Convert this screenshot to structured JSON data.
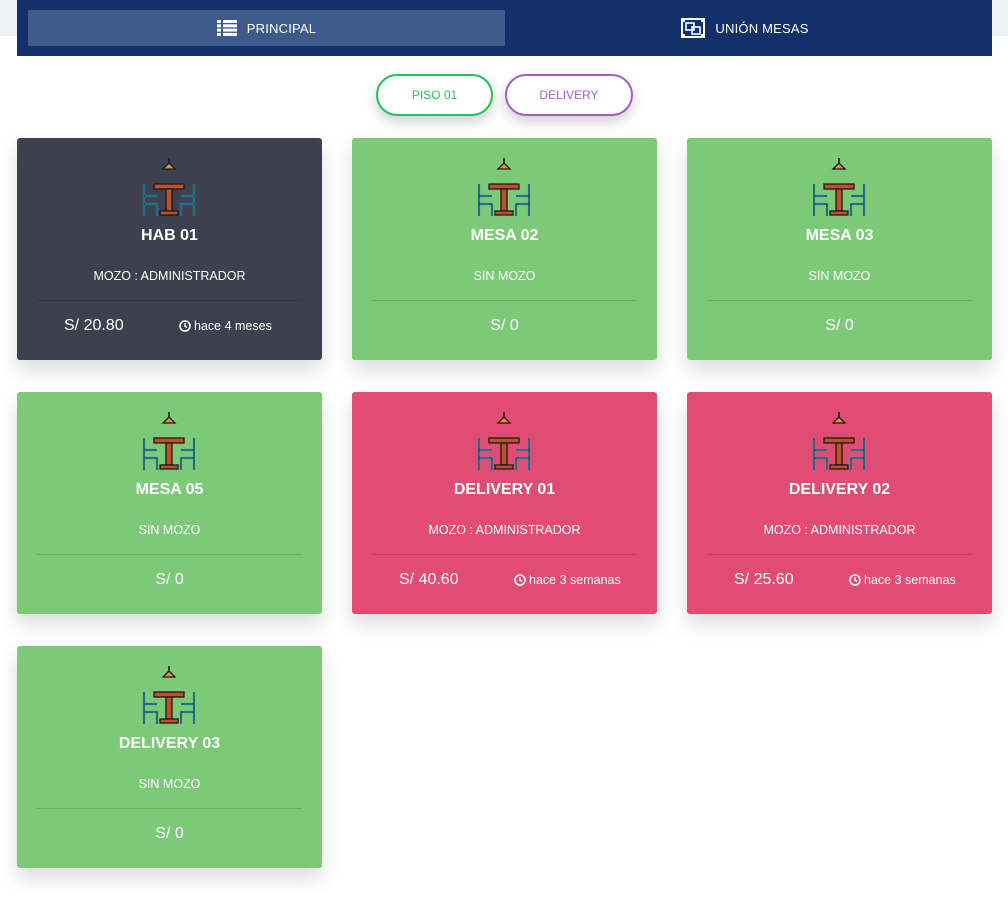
{
  "nav": {
    "tabs": [
      {
        "label": "PRINCIPAL",
        "icon": "list-icon",
        "active": true
      },
      {
        "label": "UNIÓN MESAS",
        "icon": "merge-tables-icon",
        "active": false
      }
    ]
  },
  "filters": [
    {
      "label": "PISO 01",
      "color": "#22c15a"
    },
    {
      "label": "DELIVERY",
      "color": "#a45bd0"
    }
  ],
  "colors": {
    "navbar": "#13306a",
    "occupied": "#3d414f",
    "free": "#7cc978",
    "delivery": "#e04c73"
  },
  "tables": [
    {
      "name": "HAB 01",
      "waiter": "MOZO : ADMINISTRADOR",
      "amount": "S/ 20.80",
      "time": "hace 4 meses",
      "status": "occupied"
    },
    {
      "name": "MESA 02",
      "waiter": "SIN MOZO",
      "amount": "S/ 0",
      "time": "",
      "status": "free"
    },
    {
      "name": "MESA 03",
      "waiter": "SIN MOZO",
      "amount": "S/ 0",
      "time": "",
      "status": "free"
    },
    {
      "name": "MESA 05",
      "waiter": "SIN MOZO",
      "amount": "S/ 0",
      "time": "",
      "status": "free"
    },
    {
      "name": "DELIVERY 01",
      "waiter": "MOZO : ADMINISTRADOR",
      "amount": "S/ 40.60",
      "time": "hace 3 semanas",
      "status": "delivery"
    },
    {
      "name": "DELIVERY 02",
      "waiter": "MOZO : ADMINISTRADOR",
      "amount": "S/ 25.60",
      "time": "hace 3 semanas",
      "status": "delivery"
    },
    {
      "name": "DELIVERY 03",
      "waiter": "SIN MOZO",
      "amount": "S/ 0",
      "time": "",
      "status": "free"
    }
  ]
}
